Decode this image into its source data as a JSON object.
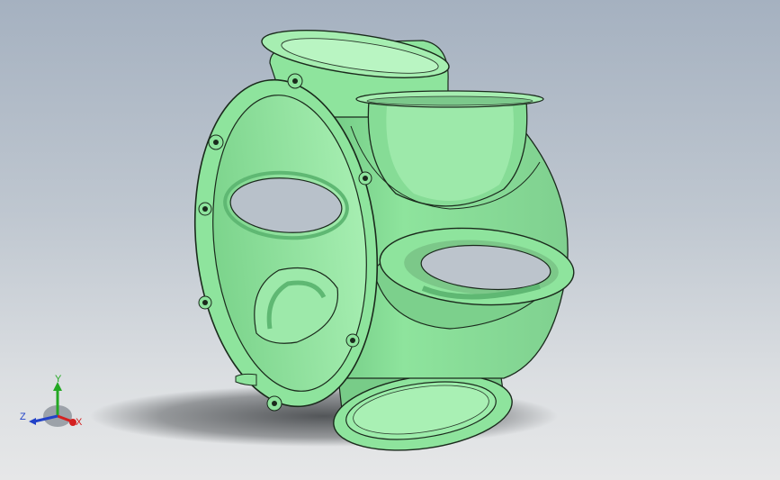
{
  "viewport": {
    "background_top": "#a5b1c0",
    "background_bottom": "#e6e7e8"
  },
  "model": {
    "body_color": "#8ee49d",
    "shade_color": "#5fb873",
    "highlight_color": "#b9f5c2",
    "edge_color": "#1a2a1c",
    "shadow_color": "#3a3d40"
  },
  "triad": {
    "x_label": "X",
    "y_label": "Y",
    "z_label": "Z",
    "x_color": "#d42020",
    "y_color": "#23a823",
    "z_color": "#2242c8",
    "icon": "coordinate-triad-icon"
  }
}
